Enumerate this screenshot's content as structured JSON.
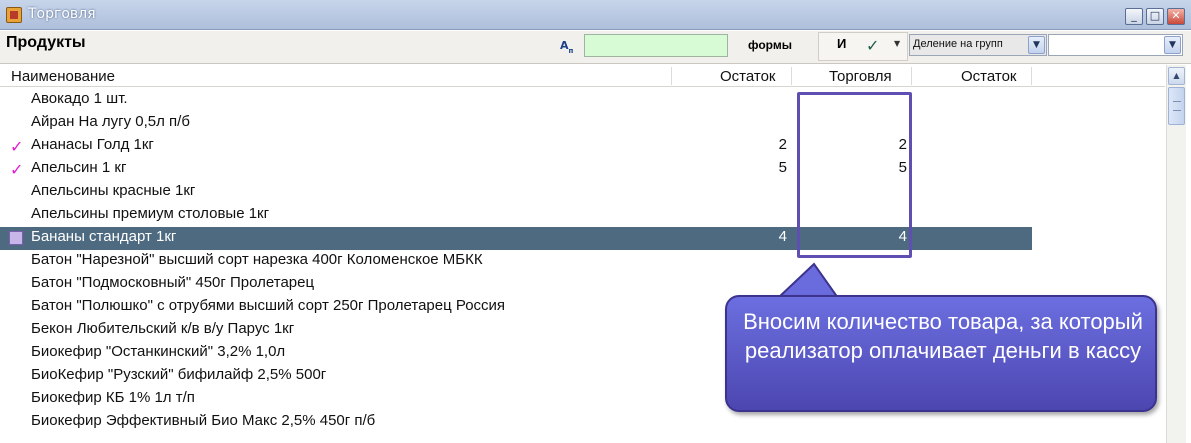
{
  "window": {
    "title": "Торговля",
    "buttons": [
      "minimize",
      "maximize",
      "close"
    ]
  },
  "toolbar": {
    "section_title": "Продукты",
    "font_icon": "A",
    "filter_value": "",
    "forms_label": "формы",
    "and_label": "И",
    "group_select_value": "Деление на групп",
    "second_select_value": ""
  },
  "grid": {
    "headers": [
      "Наименование",
      "Остаток",
      "Торговля",
      "Остаток"
    ],
    "rows": [
      {
        "name": "Авокадо 1 шт.",
        "stock": "",
        "trade": "",
        "mark": ""
      },
      {
        "name": "Айран На лугу 0,5л п/б",
        "stock": "",
        "trade": "",
        "mark": ""
      },
      {
        "name": "Ананасы Голд 1кг",
        "stock": "2",
        "trade": "2",
        "mark": "check"
      },
      {
        "name": "Апельсин 1 кг",
        "stock": "5",
        "trade": "5",
        "mark": "check"
      },
      {
        "name": "Апельсины красные 1кг",
        "stock": "",
        "trade": "",
        "mark": ""
      },
      {
        "name": "Апельсины премиум столовые 1кг",
        "stock": "",
        "trade": "",
        "mark": ""
      },
      {
        "name": "Бананы стандарт 1кг",
        "stock": "4",
        "trade": "4",
        "mark": "selected"
      },
      {
        "name": "Батон \"Нарезной\" высший сорт нарезка 400г Коломенское МБКК",
        "stock": "",
        "trade": "",
        "mark": ""
      },
      {
        "name": "Батон \"Подмосковный\" 450г Пролетарец",
        "stock": "",
        "trade": "",
        "mark": ""
      },
      {
        "name": "Батон \"Полюшко\" с отрубями высший сорт 250г Пролетарец Россия",
        "stock": "",
        "trade": "",
        "mark": ""
      },
      {
        "name": "Бекон Любительский к/в в/у Парус 1кг",
        "stock": "",
        "trade": "",
        "mark": ""
      },
      {
        "name": "Биокефир \"Останкинский\" 3,2% 1,0л",
        "stock": "",
        "trade": "",
        "mark": ""
      },
      {
        "name": "БиоКефир \"Рузский\" бифилайф 2,5% 500г",
        "stock": "",
        "trade": "",
        "mark": ""
      },
      {
        "name": "Биокефир КБ 1% 1л т/п",
        "stock": "",
        "trade": "",
        "mark": ""
      },
      {
        "name": "Биокефир Эффективный Био Макс 2,5% 450г п/б",
        "stock": "",
        "trade": "",
        "mark": ""
      }
    ],
    "colors": {
      "selected_row": "#4d6a80",
      "check_mark": "#e21bd7",
      "highlight_frame": "#5f4fb3"
    }
  },
  "callout": {
    "text": "Вносим количество товара, за который реализатор оплачивает деньги в кассу"
  },
  "icons": {
    "check": "✓",
    "dropdown": "▼",
    "scroll_up": "▲"
  }
}
